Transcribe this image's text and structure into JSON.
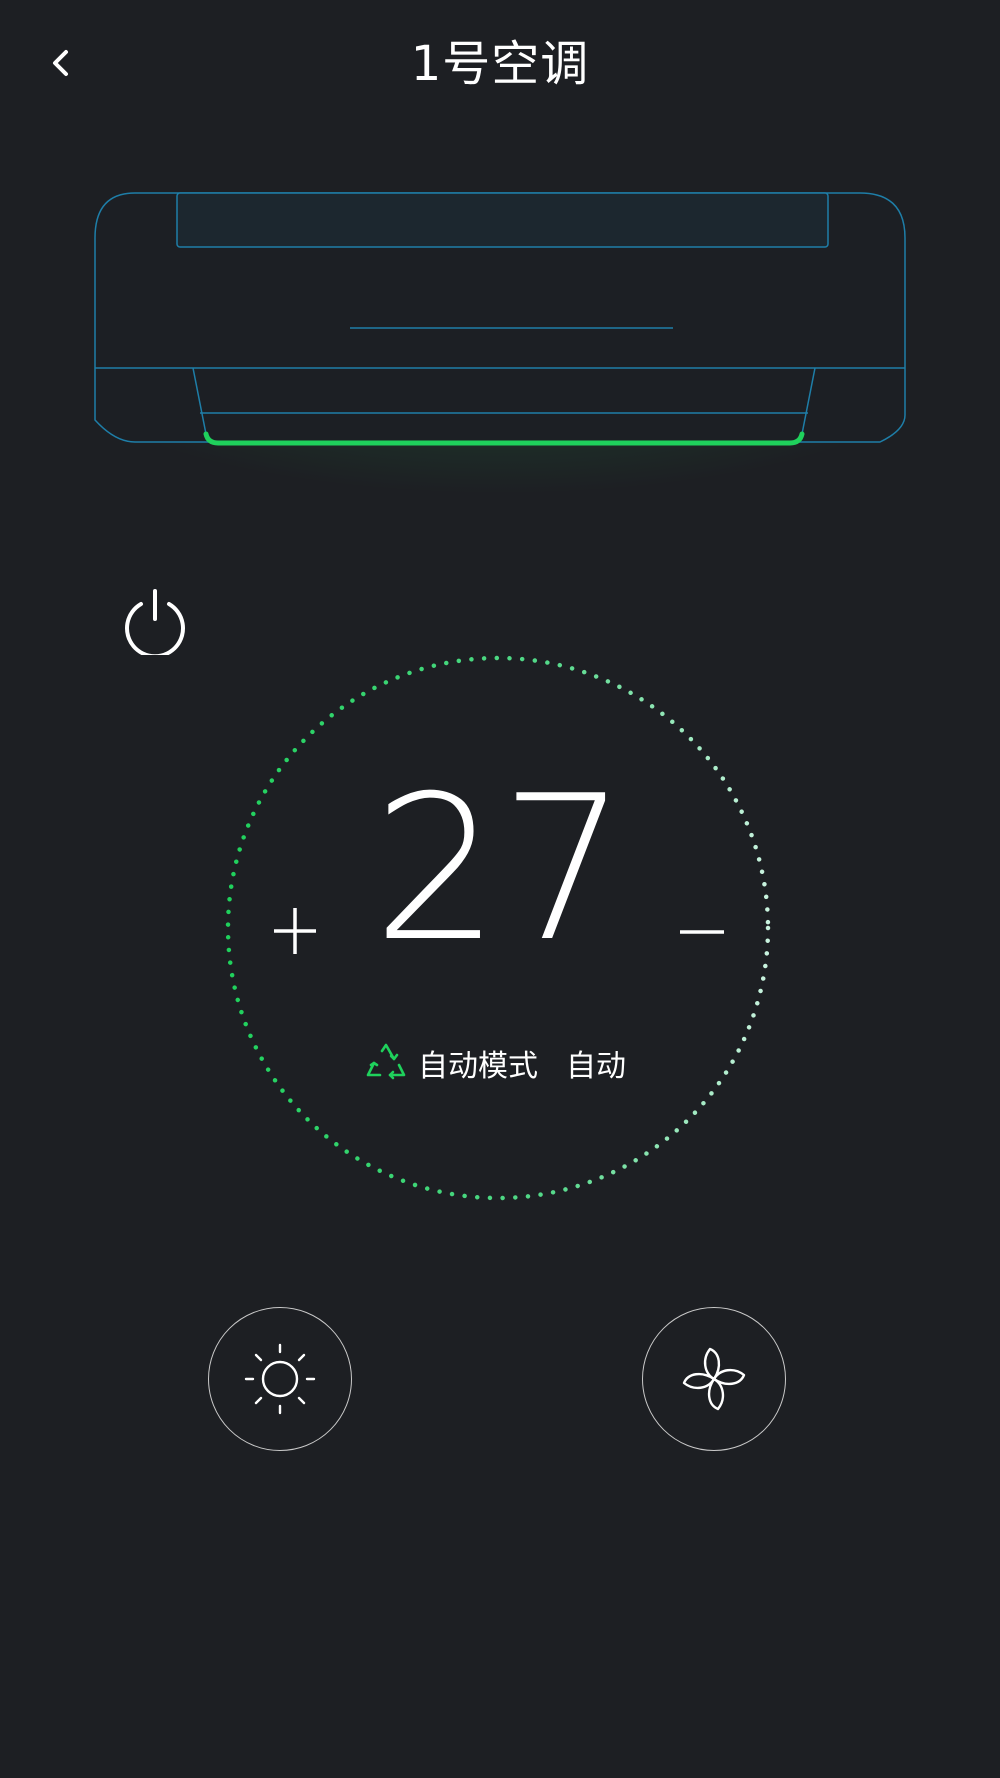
{
  "header": {
    "title": "1号空调",
    "back_icon": "chevron-left-icon"
  },
  "status": {
    "power_icon": "power-icon",
    "accent_color": "#1fd15c"
  },
  "temperature": {
    "value": "27",
    "increase_label": "+",
    "decrease_label": "−"
  },
  "mode": {
    "icon": "recycle-triangle-icon",
    "mode_label": "自动模式",
    "fan_label": "自动"
  },
  "controls": {
    "sun_icon": "sun-icon",
    "fan_icon": "fan-icon"
  },
  "colors": {
    "background": "#1d1f23",
    "ac_outline": "#1e7ea8",
    "light_strip": "#1fd15c"
  }
}
